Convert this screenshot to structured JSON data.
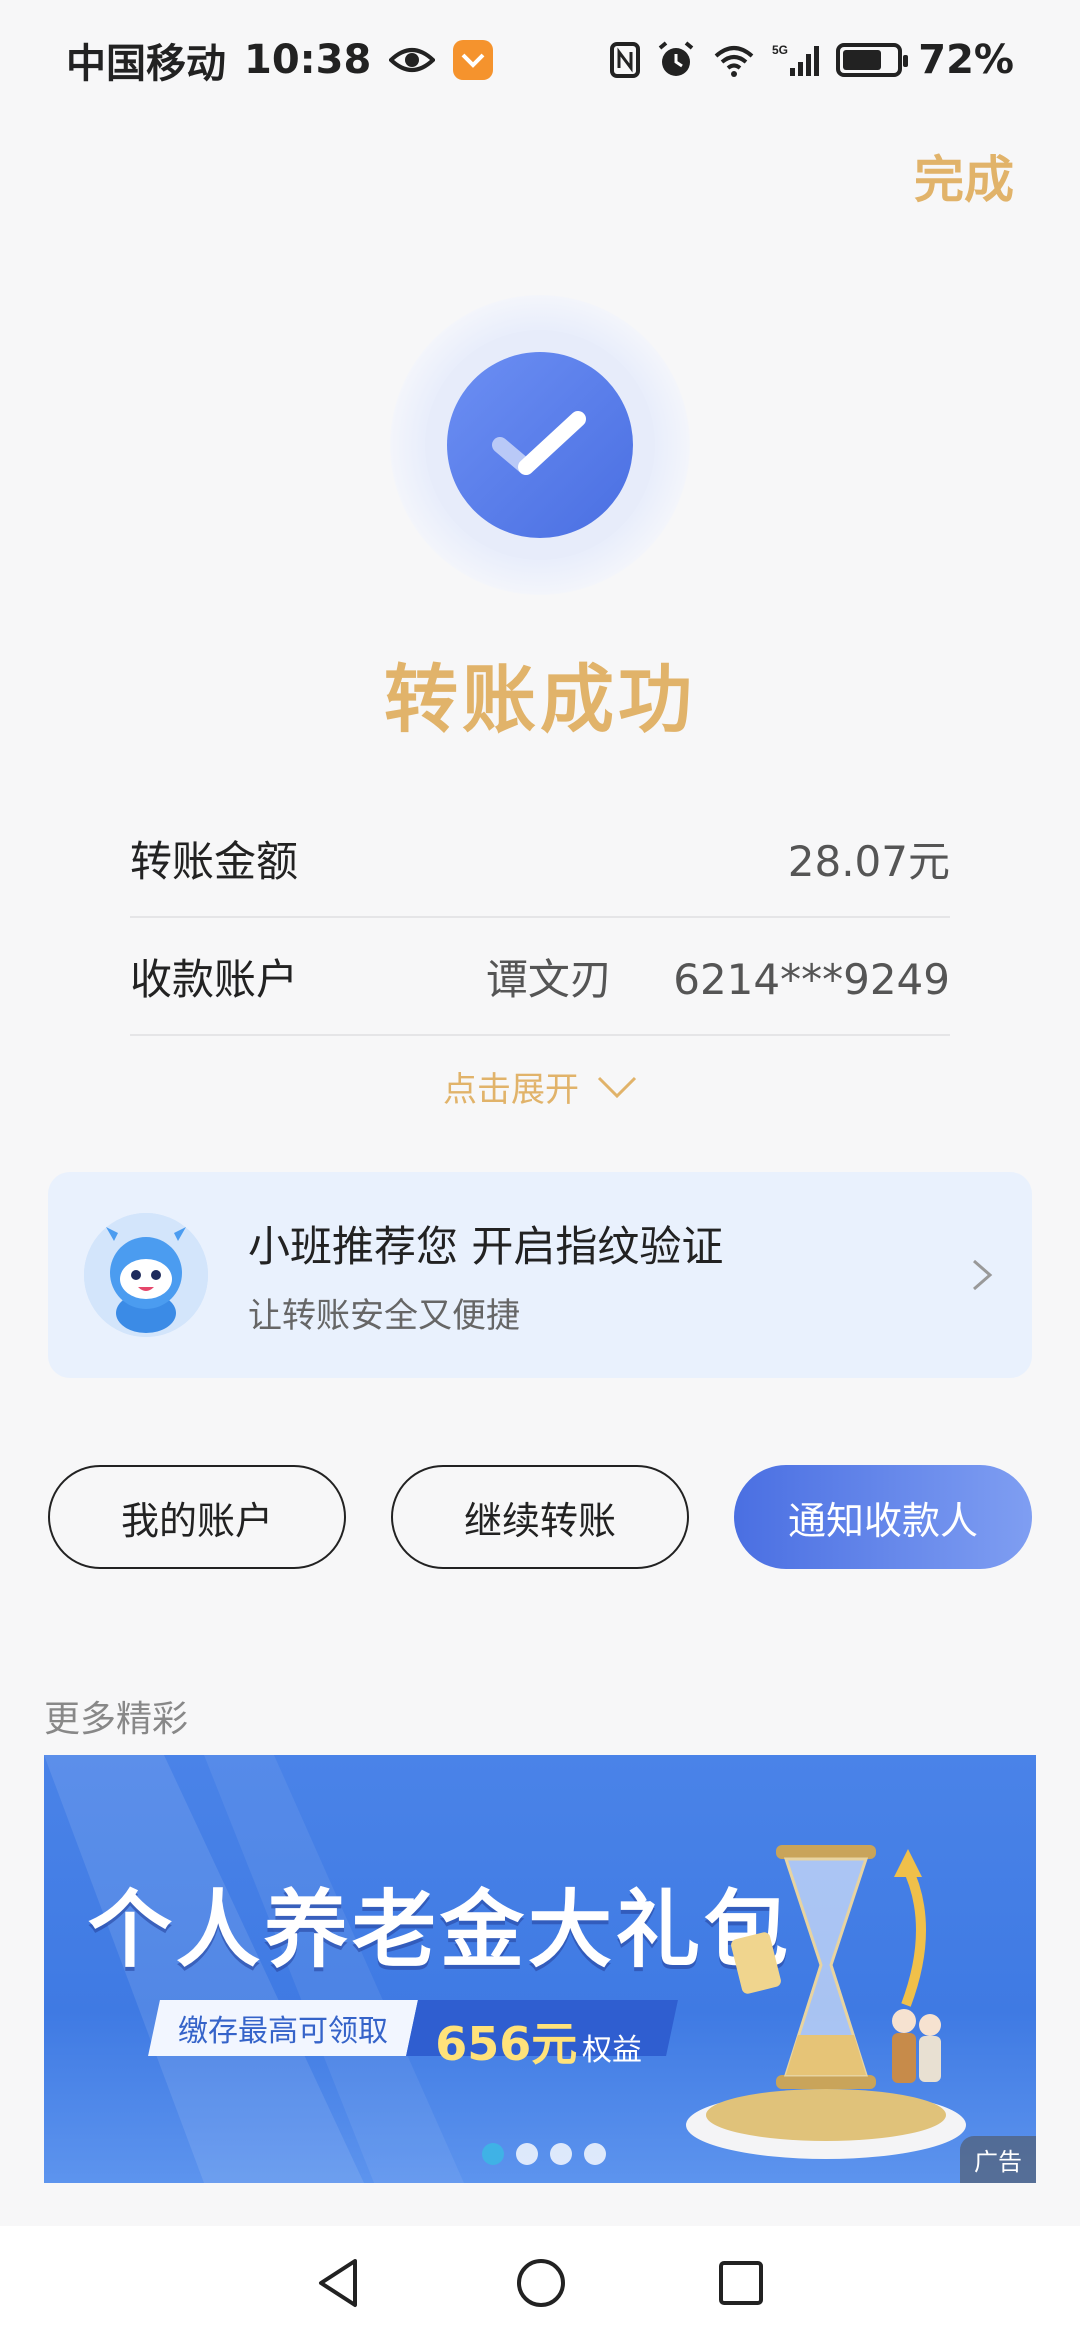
{
  "status_bar": {
    "carrier": "中国移动",
    "time": "10:38",
    "battery_percent": "72%",
    "battery_level": 0.72
  },
  "header": {
    "done_label": "完成"
  },
  "result": {
    "title": "转账成功"
  },
  "details": {
    "amount_label": "转账金额",
    "amount_value": "28.07元",
    "account_label": "收款账户",
    "account_name": "谭文刃",
    "account_number": "6214***9249",
    "expand_label": "点击展开"
  },
  "promo": {
    "title": "小班推荐您 开启指纹验证",
    "subtitle": "让转账安全又便捷"
  },
  "actions": {
    "my_account": "我的账户",
    "continue_transfer": "继续转账",
    "notify_payee": "通知收款人"
  },
  "more_section": {
    "label": "更多精彩"
  },
  "banner": {
    "title": "个人养老金大礼包",
    "tag_text": "缴存最高可领取",
    "tag_amount": "656元",
    "tag_suffix": "权益",
    "ad_label": "广告",
    "slide_count": 4,
    "active_slide": 1
  },
  "colors": {
    "accent_gold": "#e1b36a",
    "primary_blue": "#4a6fe2"
  }
}
